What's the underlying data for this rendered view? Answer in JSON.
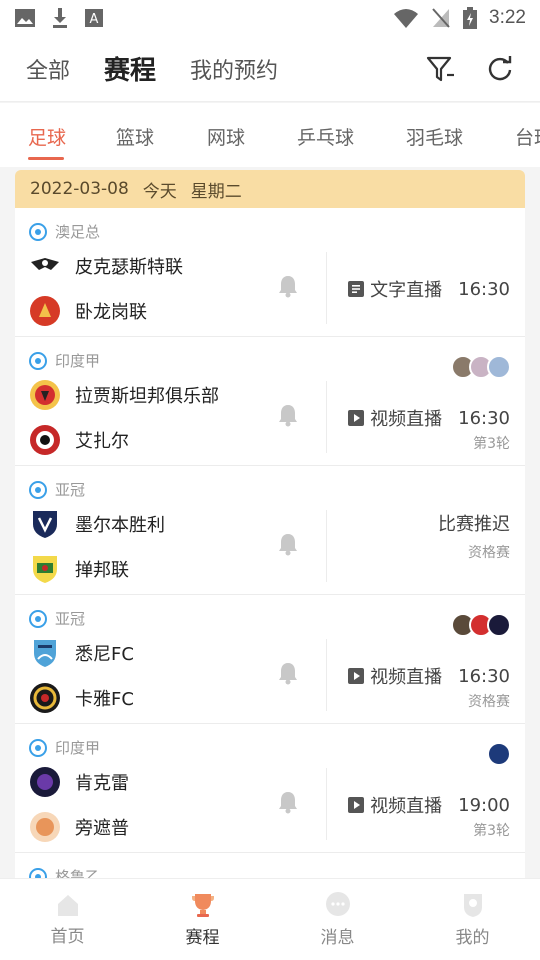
{
  "status_bar": {
    "time": "3:22"
  },
  "top_nav": {
    "tabs": [
      {
        "label": "全部"
      },
      {
        "label": "赛程"
      },
      {
        "label": "我的预约"
      }
    ],
    "active_tab": "赛程"
  },
  "sport_tabs": [
    {
      "label": "足球"
    },
    {
      "label": "篮球"
    },
    {
      "label": "网球"
    },
    {
      "label": "乒乓球"
    },
    {
      "label": "羽毛球"
    },
    {
      "label": "台球"
    }
  ],
  "date_bar": {
    "date": "2022-03-08",
    "today": "今天",
    "weekday": "星期二"
  },
  "matches": [
    {
      "league": "澳足总",
      "home": "皮克瑟斯特联",
      "away": "卧龙岗联",
      "live_type": "文字直播",
      "time": "16:30",
      "round": ""
    },
    {
      "league": "印度甲",
      "home": "拉贾斯坦邦俱乐部",
      "away": "艾扎尔",
      "live_type": "视频直播",
      "time": "16:30",
      "round": "第3轮"
    },
    {
      "league": "亚冠",
      "home": "墨尔本胜利",
      "away": "掸邦联",
      "status": "比赛推迟",
      "round": "资格赛"
    },
    {
      "league": "亚冠",
      "home": "悉尼FC",
      "away": "卡雅FC",
      "live_type": "视频直播",
      "time": "16:30",
      "round": "资格赛"
    },
    {
      "league": "印度甲",
      "home": "肯克雷",
      "away": "旁遮普",
      "live_type": "视频直播",
      "time": "19:00",
      "round": "第3轮"
    },
    {
      "league": "格鲁乙"
    }
  ],
  "bottom_nav": [
    {
      "label": "首页"
    },
    {
      "label": "赛程"
    },
    {
      "label": "消息"
    },
    {
      "label": "我的"
    }
  ],
  "colors": {
    "accent": "#e8674e",
    "date_bar": "#f9dda4",
    "league_icon": "#3aa0e8"
  }
}
